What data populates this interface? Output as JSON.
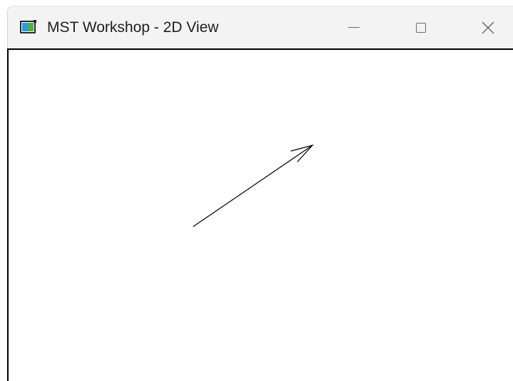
{
  "window": {
    "title": "MST Workshop - 2D View",
    "icon": "app-window-icon",
    "controls": {
      "minimize_icon": "minimize-icon",
      "maximize_icon": "maximize-icon",
      "close_icon": "close-icon"
    }
  },
  "canvas": {
    "background": "#ffffff",
    "stroke_color": "#000000",
    "shapes": [
      {
        "type": "arrow",
        "name": "vector-arrow"
      }
    ]
  }
}
